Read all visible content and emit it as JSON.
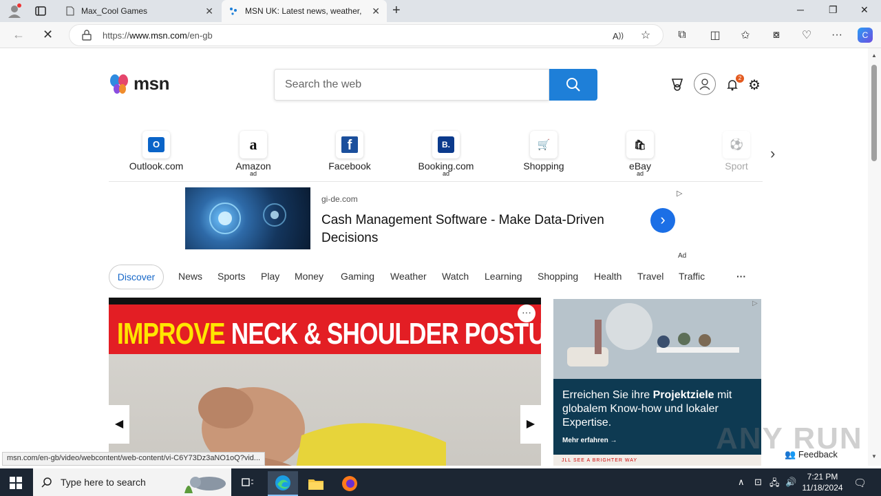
{
  "browser": {
    "tabs": [
      {
        "title": "Max_Cool Games",
        "active": false
      },
      {
        "title": "MSN UK: Latest news, weather, H",
        "active": true
      }
    ],
    "url_prefix": "https://",
    "url_host": "www.msn.com",
    "url_path": "/en-gb",
    "status_url": "msn.com/en-gb/video/webcontent/web-content/vi-C6Y73Dz3aNO1oQ?vid..."
  },
  "header": {
    "logo_text": "msn",
    "search_placeholder": "Search the web",
    "notification_count": "2"
  },
  "quicklinks": [
    {
      "label": "Outlook.com",
      "ad": "",
      "tile": "O",
      "color": "#0a64c8"
    },
    {
      "label": "Amazon",
      "ad": "ad",
      "tile": "a",
      "color": "#111111"
    },
    {
      "label": "Facebook",
      "ad": "",
      "tile": "f",
      "color": "#1b4f9c"
    },
    {
      "label": "Booking.com",
      "ad": "ad",
      "tile": "B.",
      "color": "#0b3a8c"
    },
    {
      "label": "Shopping",
      "ad": "",
      "tile": "🛒",
      "color": "#1e7fd8"
    },
    {
      "label": "eBay",
      "ad": "ad",
      "tile": "🛍",
      "color": "#e8a400"
    },
    {
      "label": "Sport",
      "ad": "",
      "tile": "⚽",
      "color": "#bbbbbb"
    }
  ],
  "ad_banner": {
    "domain": "gi-de.com",
    "headline": "Cash Management Software - Make Data-Driven Decisions",
    "label": "Ad"
  },
  "nav_tabs": {
    "active": "Discover",
    "items": [
      "News",
      "Sports",
      "Play",
      "Money",
      "Gaming",
      "Weather",
      "Watch",
      "Learning",
      "Shopping",
      "Health",
      "Travel",
      "Traffic"
    ],
    "more": "···"
  },
  "hero": {
    "title_highlight": "IMPROVE",
    "title_rest": " NECK & SHOULDER POSTURE",
    "more": "···"
  },
  "side_ad": {
    "text_plain": "Erreichen Sie ihre ",
    "text_bold": "Projektziele",
    "text_rest": " mit globalem Know-how und lokaler Expertise.",
    "cta": "Mehr erfahren →",
    "footer": "JLL  SEE A BRIGHTER WAY"
  },
  "feedback": "Feedback",
  "watermark": "ANY RUN",
  "taskbar": {
    "search_placeholder": "Type here to search",
    "time": "7:21 PM",
    "date": "11/18/2024"
  },
  "colors": {
    "accent": "#1e7fd8",
    "ad_button": "#1b6fe6",
    "hero_banner": "#e31e24",
    "taskbar": "#1c2633"
  }
}
